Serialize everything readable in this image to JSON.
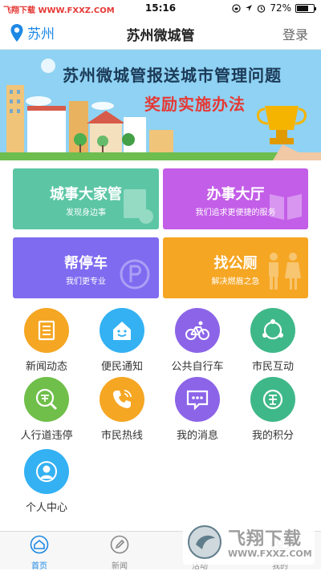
{
  "status_bar": {
    "watermark": "飞翔下载 WWW.FXXZ.COM",
    "time": "15:16",
    "battery_text": "72%",
    "battery_level": 0.72
  },
  "nav": {
    "city": "苏州",
    "title": "苏州微城管",
    "login": "登录"
  },
  "banner": {
    "line1": "苏州微城管报送城市管理问题",
    "line2": "奖励实施办法"
  },
  "tiles": [
    {
      "title": "城事大家管",
      "subtitle": "发现身边事",
      "color": "#5cc6a4"
    },
    {
      "title": "办事大厅",
      "subtitle": "我们追求更便捷的服务",
      "color": "#c35ee8"
    },
    {
      "title": "帮停车",
      "subtitle": "我们更专业",
      "color": "#7f6bf0"
    },
    {
      "title": "找公厕",
      "subtitle": "解决燃眉之急",
      "color": "#f5a623"
    }
  ],
  "grid": [
    {
      "label": "新闻动态",
      "icon": "newspaper-icon",
      "color": "#f5a623"
    },
    {
      "label": "便民通知",
      "icon": "house-smile-icon",
      "color": "#33b1f3"
    },
    {
      "label": "公共自行车",
      "icon": "bicycle-icon",
      "color": "#8c64e8"
    },
    {
      "label": "市民互动",
      "icon": "interaction-icon",
      "color": "#3fb889"
    },
    {
      "label": "人行道违停",
      "icon": "violation-icon",
      "color": "#6fbf4a"
    },
    {
      "label": "市民热线",
      "icon": "phone-icon",
      "color": "#f5a623"
    },
    {
      "label": "我的消息",
      "icon": "message-icon",
      "color": "#8c64e8"
    },
    {
      "label": "我的积分",
      "icon": "points-icon",
      "color": "#3fb889"
    },
    {
      "label": "个人中心",
      "icon": "user-icon",
      "color": "#33b1f3"
    }
  ],
  "tabbar": [
    {
      "label": "首页",
      "icon": "home-icon"
    },
    {
      "label": "新闻",
      "icon": "pen-icon"
    },
    {
      "label": "活动",
      "icon": "activity-icon"
    },
    {
      "label": "我的",
      "icon": "profile-icon"
    }
  ],
  "watermark_overlay": {
    "brand": "飞翔下载",
    "url": "WWW.FXXZ.COM"
  }
}
